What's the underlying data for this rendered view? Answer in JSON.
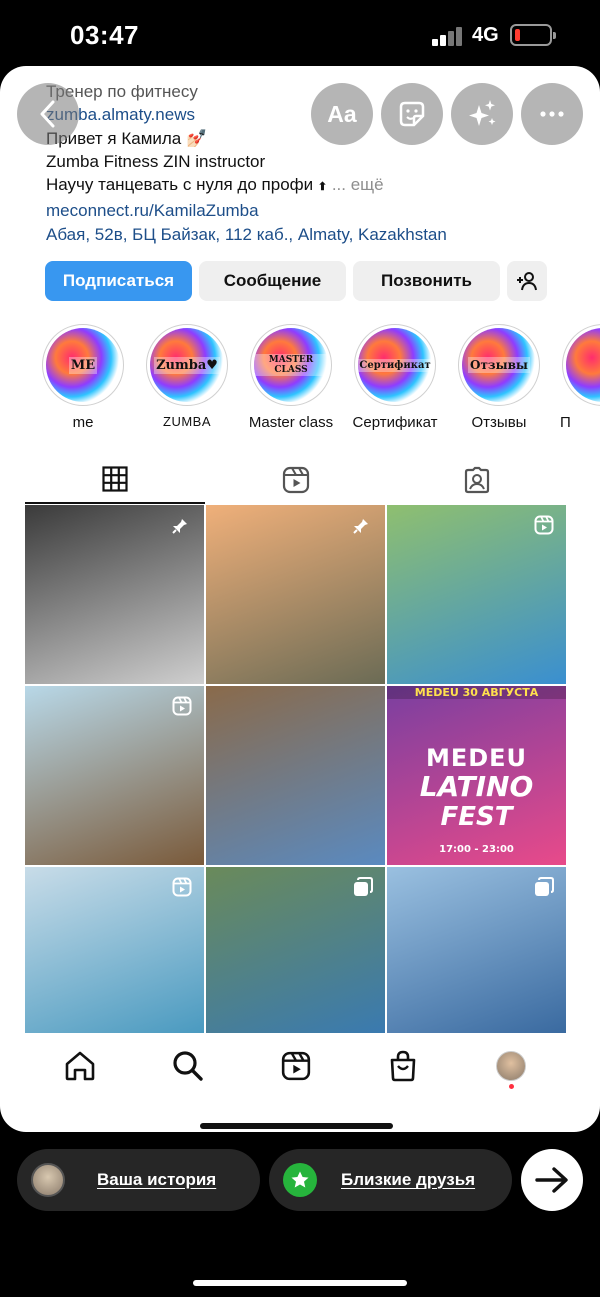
{
  "status": {
    "time": "03:47",
    "network": "4G"
  },
  "profile": {
    "category": "Тренер по фитнесу",
    "link1": "zumba.almaty.news",
    "line1": "Привет я Камила 💅🏻",
    "line2": "Zumba Fitness ZIN instructor",
    "line3": "Научу танцевать с нуля до профи",
    "more": "... ещё",
    "link2": "meconnect.ru/KamilaZumba",
    "address": "Абая, 52в, БЦ Байзак, 112 каб., Almaty, Kazakhstan"
  },
  "top_buttons": {
    "text_button": "Aa"
  },
  "actions": {
    "follow": "Подписаться",
    "message": "Сообщение",
    "call": "Позвонить"
  },
  "highlights": [
    {
      "label": "me",
      "cover": "ME"
    },
    {
      "label": "ZUMBA",
      "cover": "Zumba♥"
    },
    {
      "label": "Master class",
      "cover": "MASTER CLASS"
    },
    {
      "label": "Сертификат",
      "cover": "Сертификат"
    },
    {
      "label": "Отзывы",
      "cover": "Отзывы"
    },
    {
      "label": "П",
      "cover": ""
    }
  ],
  "posts": [
    {
      "badge": "pin-icon",
      "colors": [
        "#3a3a3a",
        "#cfcfcf"
      ]
    },
    {
      "badge": "pin-icon",
      "colors": [
        "#f0b07a",
        "#6b6b55"
      ]
    },
    {
      "badge": "reel-icon",
      "colors": [
        "#8fbf6f",
        "#3a8fd0"
      ]
    },
    {
      "badge": "reel-icon",
      "colors": [
        "#b8d8e8",
        "#7a5a3a"
      ]
    },
    {
      "badge": "",
      "colors": [
        "#8a6a4a",
        "#5a8ac0"
      ]
    },
    {
      "badge": "",
      "colors": [
        "#7a3fa0",
        "#e84a8a"
      ],
      "poster": {
        "header": "MEDEU  30 АВГУСТА",
        "title1": "MEDEU",
        "title2": "LATINO",
        "title3": "FEST",
        "time": "17:00 - 23:00"
      }
    },
    {
      "badge": "reel-icon",
      "colors": [
        "#c8dce8",
        "#4a9ac0"
      ]
    },
    {
      "badge": "carousel-icon",
      "colors": [
        "#6a8a5a",
        "#3a7ab0"
      ]
    },
    {
      "badge": "carousel-icon",
      "colors": [
        "#9ac0e0",
        "#3a6aa0"
      ]
    }
  ],
  "share": {
    "story": "Ваша история",
    "friends": "Близкие друзья"
  },
  "colors": {
    "accent": "#3897f0",
    "pill": "#262626",
    "link": "#1d4e89",
    "battery_low": "#ff3b30"
  }
}
